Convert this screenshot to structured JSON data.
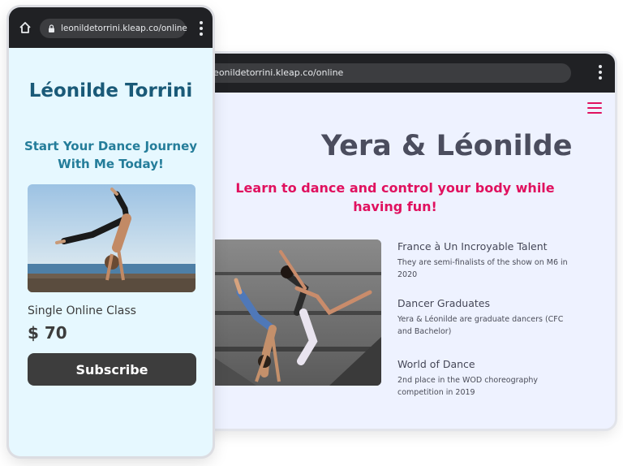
{
  "desktop": {
    "url": "leonildetorrini.kleap.co/online",
    "title": "Yera & Léonilde",
    "subtitle": "Learn to dance and control your body while having fun!",
    "features": [
      {
        "title": "France à Un Incroyable Talent",
        "text": "They are semi-finalists of the show on M6 in 2020"
      },
      {
        "title": "Dancer Graduates",
        "text": "Yera & Léonilde are graduate dancers (CFC and Bachelor)"
      },
      {
        "title": "World of Dance",
        "text": "2nd place in the WOD choreography competition in 2019"
      }
    ],
    "menu_icon": "hamburger-icon",
    "accent": "#e0115f"
  },
  "mobile": {
    "url": "leonildetorrini.kleap.co/online",
    "name": "Léonilde Torrini",
    "tagline": "Start Your Dance Journey With Me Today!",
    "class_label": "Single Online Class",
    "price": "$ 70",
    "cta_label": "Subscribe",
    "accent": "#247d9a"
  }
}
